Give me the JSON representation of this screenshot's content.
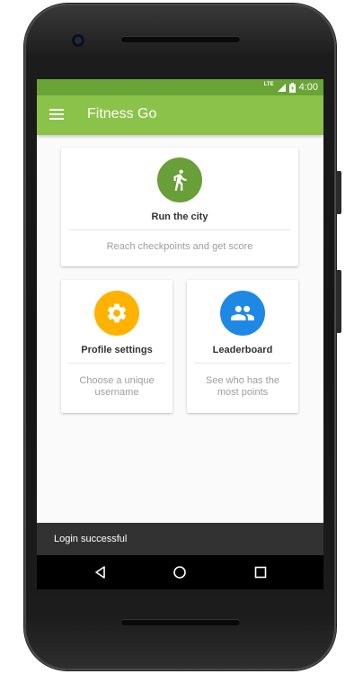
{
  "status_bar": {
    "network_label": "LTE",
    "time": "4:00"
  },
  "toolbar": {
    "title": "Fitness Go",
    "menu_icon": "hamburger-menu-icon"
  },
  "cards": [
    {
      "title": "Run the city",
      "description": "Reach checkpoints and get score",
      "icon": "running-person-icon",
      "color": "#689f38"
    },
    {
      "title": "Profile settings",
      "description": "Choose a unique username",
      "icon": "gear-icon",
      "color": "#ffb300"
    },
    {
      "title": "Leaderboard",
      "description": "See who has the most points",
      "icon": "group-people-icon",
      "color": "#1e88e5"
    }
  ],
  "snackbar": {
    "message": "Login successful"
  },
  "navigation": {
    "back_icon": "back-triangle-icon",
    "home_icon": "home-circle-icon",
    "recents_icon": "recents-square-icon"
  },
  "colors": {
    "status_bar": "#6aa336",
    "toolbar": "#8bc34a",
    "background": "#fafafa",
    "snackbar": "#323232"
  }
}
